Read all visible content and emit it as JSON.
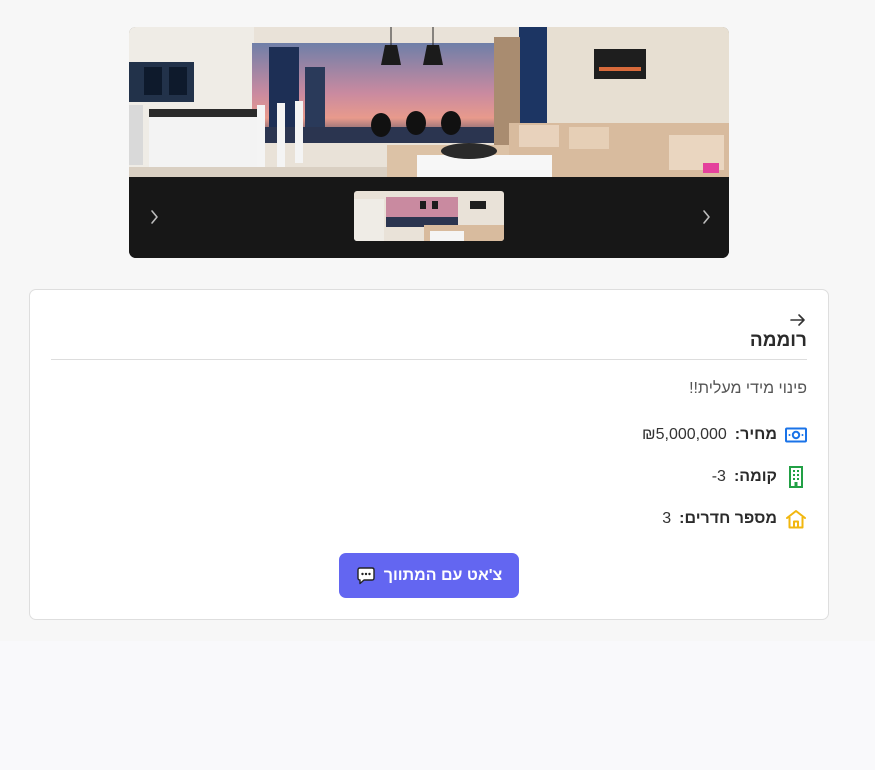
{
  "gallery": {
    "prev_icon": "chevron-left-icon",
    "next_icon": "chevron-right-icon"
  },
  "listing": {
    "title": "רוממה",
    "description": "פינוי מידי מעלית!!",
    "price": {
      "label": "מחיר:",
      "value": "₪5,000,000",
      "icon": "cash-icon",
      "color": "#1a73e8"
    },
    "floor": {
      "label": "קומה:",
      "value": "-3",
      "icon": "building-icon",
      "color": "#22a045"
    },
    "rooms": {
      "label": "מספר חדרים:",
      "value": "3",
      "icon": "home-icon",
      "color": "#f2b70f"
    }
  },
  "actions": {
    "chat_label": "צ'אט עם המתווך",
    "chat_icon": "chat-bubble-icon",
    "back_icon": "arrow-right-icon"
  },
  "colors": {
    "accent": "#6366f1",
    "gallery_bg": "#171717"
  }
}
